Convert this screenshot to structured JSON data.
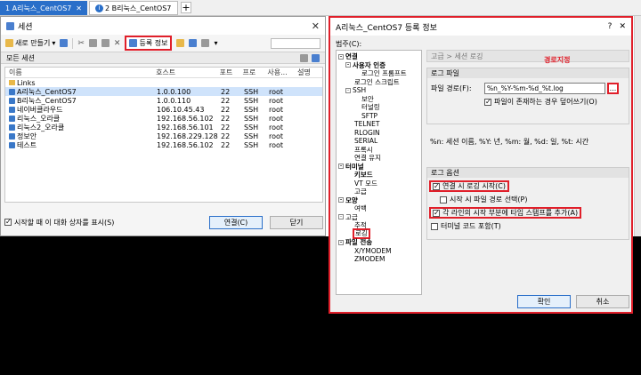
{
  "tabs": [
    {
      "label": "1 A리눅스_CentOS7"
    },
    {
      "label": "2 B리눅스_CentOS7"
    }
  ],
  "tab_add": "+",
  "session_window": {
    "title": "세션",
    "toolbar": {
      "new_label": "새로 만들기",
      "properties_label": "등록 정보"
    },
    "all_sessions_label": "모든 세션",
    "columns": [
      "이름",
      "호스트",
      "포트",
      "프로",
      "사용...",
      "설명"
    ],
    "rows": [
      {
        "name": "Links",
        "host": "",
        "port": "",
        "protocol": "",
        "user": "",
        "type": "folder"
      },
      {
        "name": "A리눅스_CentOS7",
        "host": "1.0.0.100",
        "port": "22",
        "protocol": "SSH",
        "user": "root",
        "type": "session"
      },
      {
        "name": "B리눅스_CentOS7",
        "host": "1.0.0.110",
        "port": "22",
        "protocol": "SSH",
        "user": "root",
        "type": "session"
      },
      {
        "name": "네이버클라우드",
        "host": "106.10.45.43",
        "port": "22",
        "protocol": "SSH",
        "user": "root",
        "type": "session"
      },
      {
        "name": "리눅스_오라클",
        "host": "192.168.56.102",
        "port": "22",
        "protocol": "SSH",
        "user": "root",
        "type": "session"
      },
      {
        "name": "리눅스2_오라클",
        "host": "192.168.56.101",
        "port": "22",
        "protocol": "SSH",
        "user": "root",
        "type": "session"
      },
      {
        "name": "정보안",
        "host": "192.168.229.128",
        "port": "22",
        "protocol": "SSH",
        "user": "root",
        "type": "session"
      },
      {
        "name": "테스트",
        "host": "192.168.56.102",
        "port": "22",
        "protocol": "SSH",
        "user": "root",
        "type": "session"
      }
    ],
    "show_on_start_label": "시작할 때 이 대화 상자를 표시(S)",
    "connect_label": "연결(C)",
    "close_label": "닫기"
  },
  "props_window": {
    "title": "A리눅스_CentOS7 등록 정보",
    "help": "?",
    "category_label": "범주(C):",
    "tree": [
      {
        "label": "연결",
        "level": 0,
        "bold": true,
        "box": "-"
      },
      {
        "label": "사용자 인증",
        "level": 1,
        "bold": true,
        "box": "-"
      },
      {
        "label": "로그인 프롬프트",
        "level": 2
      },
      {
        "label": "로그인 스크립트",
        "level": 1
      },
      {
        "label": "SSH",
        "level": 1,
        "box": "-"
      },
      {
        "label": "보안",
        "level": 2
      },
      {
        "label": "터널링",
        "level": 2
      },
      {
        "label": "SFTP",
        "level": 2
      },
      {
        "label": "TELNET",
        "level": 1
      },
      {
        "label": "RLOGIN",
        "level": 1
      },
      {
        "label": "SERIAL",
        "level": 1
      },
      {
        "label": "프록시",
        "level": 1
      },
      {
        "label": "연결 유지",
        "level": 1
      },
      {
        "label": "터미널",
        "level": 0,
        "bold": true,
        "box": "-"
      },
      {
        "label": "키보드",
        "level": 1,
        "bold": true
      },
      {
        "label": "VT 모드",
        "level": 1
      },
      {
        "label": "고급",
        "level": 1
      },
      {
        "label": "모양",
        "level": 0,
        "bold": true,
        "box": "-"
      },
      {
        "label": "여백",
        "level": 1
      },
      {
        "label": "고급",
        "level": 0,
        "box": "-"
      },
      {
        "label": "추적",
        "level": 1
      },
      {
        "label": "로깅",
        "level": 1,
        "selected": true
      },
      {
        "label": "파일 전송",
        "level": 0,
        "bold": true,
        "box": "-"
      },
      {
        "label": "X/YMODEM",
        "level": 1
      },
      {
        "label": "ZMODEM",
        "level": 1
      }
    ],
    "breadcrumb": "고급 > 세션 로깅",
    "log_file_group": "로그 파일",
    "file_path_label": "파일 경로(F):",
    "file_path_value": "%n_%Y-%m-%d_%t.log",
    "browse_label": "...",
    "annotation": "경로지정",
    "overwrite_label": "파일이 존재하는 경우 덮어쓰기(O)",
    "format_hint": "%n: 세션 이름, %Y: 년, %m: 월, %d: 일, %t: 시간",
    "log_options_group": "로그 옵션",
    "options": [
      {
        "label": "연결 시 로깅 시작(C)",
        "checked": true,
        "highlight": true
      },
      {
        "label": "시작 시 파일 경로 선택(P)",
        "checked": false,
        "highlight": false
      },
      {
        "label": "각 라인의 시작 부분에 타임 스탬프를 추가(A)",
        "checked": true,
        "highlight": true
      },
      {
        "label": "터미널 코드 포함(T)",
        "checked": false,
        "highlight": false
      }
    ],
    "ok_label": "확인",
    "cancel_label": "취소"
  }
}
